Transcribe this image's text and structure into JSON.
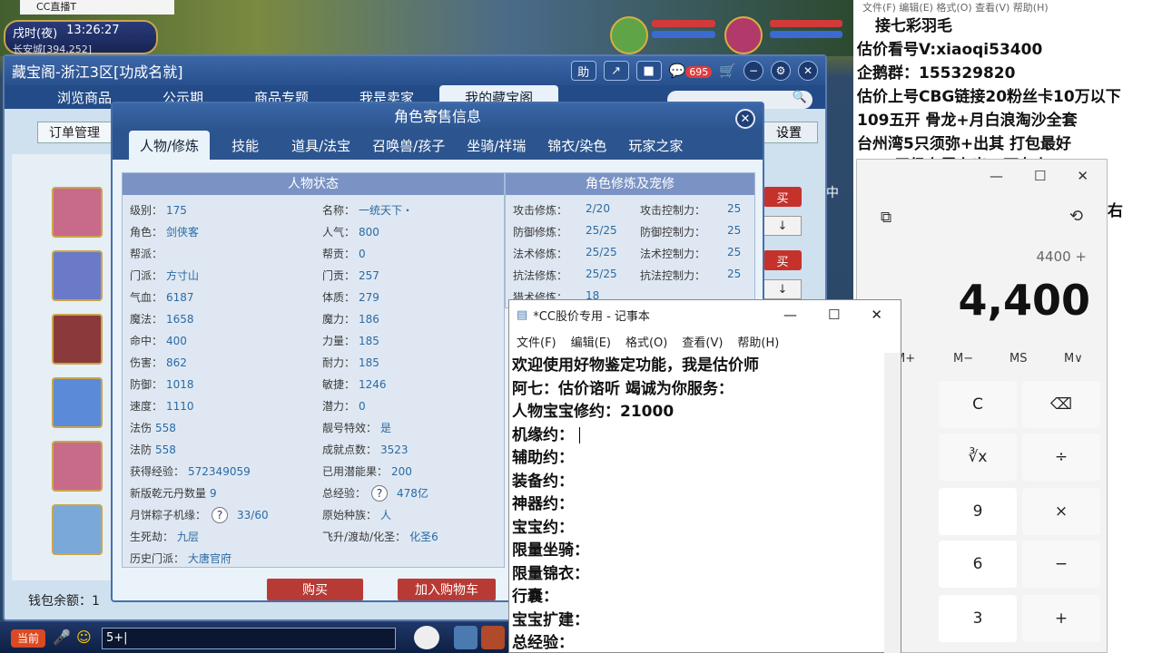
{
  "game": {
    "window_title": "CC直播T",
    "time_period": "戌时(夜)",
    "clock": "13:26:27",
    "location": "长安城[394,252]",
    "chat_button": "当前",
    "chat_input": "5+|"
  },
  "treasure": {
    "title": "藏宝阁-浙江3区[功成名就]",
    "help_label": "助",
    "badge_count": "695",
    "tabs": [
      "浏览商品",
      "公示期",
      "商品专题",
      "我是卖家",
      "我的藏宝阁"
    ],
    "order_button": "订单管理",
    "settings_button": "设置",
    "side_buy": "买",
    "side_arrow": "↓",
    "side_text": "中",
    "wallet_label": "钱包余额：1"
  },
  "role": {
    "title": "角色寄售信息",
    "tabs": [
      "人物/修炼",
      "技能",
      "道具/法宝",
      "召唤兽/孩子",
      "坐骑/祥瑞",
      "锦衣/染色",
      "玩家之家"
    ],
    "left_panel_title": "人物状态",
    "right_panel_title": "角色修炼及宠修",
    "col1": [
      {
        "k": "级别：",
        "v": "175"
      },
      {
        "k": "角色：",
        "v": "剑侠客"
      },
      {
        "k": "帮派：",
        "v": ""
      },
      {
        "k": "门派：",
        "v": "方寸山"
      },
      {
        "k": "气血：",
        "v": "6187"
      },
      {
        "k": "魔法：",
        "v": "1658"
      },
      {
        "k": "命中：",
        "v": "400"
      },
      {
        "k": "伤害：",
        "v": "862"
      },
      {
        "k": "防御：",
        "v": "1018"
      },
      {
        "k": "速度：",
        "v": "1110"
      },
      {
        "k": "法伤",
        "v": "558"
      },
      {
        "k": "法防",
        "v": "558"
      },
      {
        "k": "获得经验：",
        "v": "572349059"
      },
      {
        "k": "新版乾元丹数量",
        "v": "9"
      },
      {
        "k": "月饼粽子机缘：",
        "v": "33/60"
      },
      {
        "k": "生死劫：",
        "v": "九层"
      },
      {
        "k": "历史门派：",
        "v": "大唐官府"
      }
    ],
    "col2": [
      {
        "k": "名称：",
        "v": "一统天下・"
      },
      {
        "k": "人气：",
        "v": "800"
      },
      {
        "k": "帮贡：",
        "v": "0"
      },
      {
        "k": "门贡：",
        "v": "257"
      },
      {
        "k": "体质：",
        "v": "279"
      },
      {
        "k": "魔力：",
        "v": "186"
      },
      {
        "k": "力量：",
        "v": "185"
      },
      {
        "k": "耐力：",
        "v": "185"
      },
      {
        "k": "敏捷：",
        "v": "1246"
      },
      {
        "k": "潜力：",
        "v": "0"
      },
      {
        "k": "靓号特效：",
        "v": "是"
      },
      {
        "k": "成就点数：",
        "v": "3523"
      },
      {
        "k": "已用潜能果：",
        "v": "200"
      },
      {
        "k": "总经验：",
        "v": "478亿"
      },
      {
        "k": "原始种族：",
        "v": "人"
      },
      {
        "k": "飞升/渡劫/化圣：",
        "v": "化圣6"
      }
    ],
    "cultivation": [
      {
        "k": "攻击修炼：",
        "v": "2/20",
        "k2": "攻击控制力：",
        "v2": "25"
      },
      {
        "k": "防御修炼：",
        "v": "25/25",
        "k2": "防御控制力：",
        "v2": "25"
      },
      {
        "k": "法术修炼：",
        "v": "25/25",
        "k2": "法术控制力：",
        "v2": "25"
      },
      {
        "k": "抗法修炼：",
        "v": "25/25",
        "k2": "抗法控制力：",
        "v2": "25"
      },
      {
        "k": "猎术修炼：",
        "v": "18",
        "k2": "",
        "v2": ""
      }
    ],
    "buy_button": "购买",
    "cart_button": "加入购物车"
  },
  "overlay": {
    "menu": "文件(F)  编辑(E)  格式(O)  查看(V)  帮助(H)",
    "lines": [
      "接七彩羽毛",
      "估价看号V:xiaoqi53400",
      "企鹅群：155329820",
      "估价上号CBG链接20粉丝卡10万以下",
      "109五开 骨龙+月白浪淘沙全套",
      "台州湾5只须弥+出其 打包最好",
      "175 无级专属专出 0万左右"
    ],
    "side_fragment": "右"
  },
  "calculator": {
    "expression": "4400 +",
    "result": "4,400",
    "memory_keys": [
      "M+",
      "M−",
      "MS",
      "M∨"
    ],
    "keys": [
      "C",
      "⌫",
      "∛x",
      "÷",
      "9",
      "×",
      "6",
      "−",
      "3",
      "+"
    ]
  },
  "notepad": {
    "title": "*CC股价专用 - 记事本",
    "menus": [
      "文件(F)",
      "编辑(E)",
      "格式(O)",
      "查看(V)",
      "帮助(H)"
    ],
    "lines": [
      "欢迎使用好物鉴定功能，我是估价师",
      "阿七：估价谘听 竭诚为你服务：",
      "人物宝宝修约：21000",
      "机缘约：",
      "辅助约：",
      "装备约：",
      "神器约：",
      "宝宝约：",
      "限量坐骑：",
      "限量锦衣：",
      "行囊：",
      "宝宝扩建：",
      "总经验："
    ]
  },
  "colors": {
    "window_blue": "#2c558f",
    "buy_red": "#b83a34",
    "value_blue": "#2a6aa6"
  }
}
